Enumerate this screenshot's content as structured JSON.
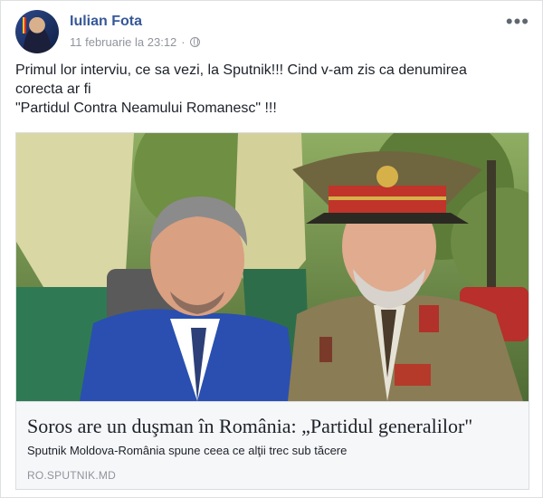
{
  "post": {
    "author_name": "Iulian Fota",
    "timestamp": "11 februarie la 23:12",
    "separator": "·",
    "privacy_icon": "globe-icon",
    "more_label": "•••",
    "text_lines": [
      "Primul lor interviu, ce sa vezi, la Sputnik!!! Cind v-am zis ca denumirea",
      "corecta ar fi",
      "\"Partidul Contra Neamului Romanesc\" !!!"
    ]
  },
  "link": {
    "title": "Soros are un duşman în România: „Partidul generalilor\"",
    "description": "Sputnik Moldova-România spune ceea ce alţii trec sub tăcere",
    "source": "RO.SPUTNIK.MD"
  },
  "colors": {
    "link_blue": "#365899",
    "meta_gray": "#90949c",
    "card_bg": "#f6f7f9",
    "border": "#dddfe2"
  }
}
